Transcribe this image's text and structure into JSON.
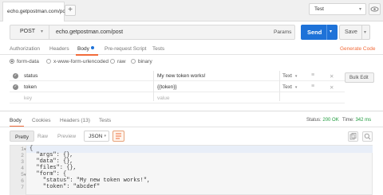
{
  "tab": {
    "label": "echo.getpostman.com/post",
    "add": "+"
  },
  "environment": {
    "label": "Test"
  },
  "request": {
    "method": "POST",
    "url": "echo.getpostman.com/post",
    "params_label": "Params",
    "send_label": "Send",
    "save_label": "Save"
  },
  "req_tabs": [
    "Authorization",
    "Headers",
    "Body",
    "Pre-request Script",
    "Tests"
  ],
  "generate_code": "Generate Code",
  "body_modes": [
    "form-data",
    "x-www-form-urlencoded",
    "raw",
    "binary"
  ],
  "form_rows": [
    {
      "key": "status",
      "value": "My new token works!",
      "type": "Text"
    },
    {
      "key": "token",
      "value": "{{token}}",
      "type": "Text"
    }
  ],
  "form_placeholder": {
    "key": "key",
    "value": "value"
  },
  "bulk_edit": "Bulk Edit",
  "response": {
    "tabs": [
      "Body",
      "Cookies",
      "Headers (13)",
      "Tests"
    ],
    "status_label": "Status:",
    "status_value": "200 OK",
    "time_label": "Time:",
    "time_value": "342 ms",
    "formats": [
      "Pretty",
      "Raw",
      "Preview"
    ],
    "lang": "JSON"
  },
  "code_lines": [
    {
      "n": "1",
      "text": "{"
    },
    {
      "n": "2",
      "text": "  \"args\": {},"
    },
    {
      "n": "3",
      "text": "  \"data\": {},"
    },
    {
      "n": "4",
      "text": "  \"files\": {},"
    },
    {
      "n": "5",
      "text": "  \"form\": {"
    },
    {
      "n": "6",
      "text": "    \"status\": \"My new token works!\","
    },
    {
      "n": "7",
      "text": "    \"token\": \"abcdef\""
    }
  ],
  "colors": {
    "accent": "#f26b3a",
    "send": "#1e72d8",
    "status_ok": "#1e9a3c"
  }
}
